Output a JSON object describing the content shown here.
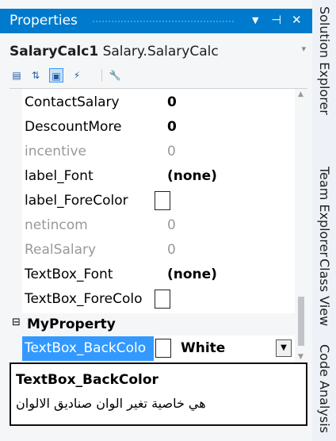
{
  "window": {
    "title": "Properties",
    "buttons": {
      "dropdown": "▼",
      "pin": "⊣",
      "close": "✕"
    }
  },
  "object_selector": {
    "name": "SalaryCalc1",
    "type": "Salary.SalaryCalc"
  },
  "toolbar": {
    "items": [
      {
        "icon": "categorized-icon",
        "state": "off"
      },
      {
        "icon": "alphabetical-icon",
        "state": "off"
      },
      {
        "icon": "properties-icon",
        "state": "on"
      },
      {
        "icon": "events-icon",
        "state": "off"
      },
      {
        "icon": "property-pages-icon",
        "state": "disabled"
      }
    ]
  },
  "properties": [
    {
      "name": "ContactSalary",
      "value": "0",
      "bold": true,
      "gray": false
    },
    {
      "name": "DescountMore",
      "value": "0",
      "bold": true,
      "gray": false
    },
    {
      "name": "incentive",
      "value": "0",
      "bold": false,
      "gray": true
    },
    {
      "name": "label_Font",
      "value": "(none)",
      "bold": true,
      "gray": false
    },
    {
      "name": "label_ForeColor",
      "value": "",
      "swatch": true,
      "gray": false
    },
    {
      "name": "netincom",
      "value": "0",
      "bold": false,
      "gray": true
    },
    {
      "name": "RealSalary",
      "value": "0",
      "bold": false,
      "gray": true
    },
    {
      "name": "TextBox_Font",
      "value": "(none)",
      "bold": true,
      "gray": false
    },
    {
      "name": "TextBox_ForeColo",
      "value": "",
      "swatch": true,
      "gray": false
    }
  ],
  "category": {
    "toggle": "⊟",
    "name": "MyProperty"
  },
  "selected_property": {
    "name": "TextBox_BackColo",
    "value": "White"
  },
  "description": {
    "title": "TextBox_BackColor",
    "text": "هي خاصية تغير الوان صناديق الالوان"
  },
  "side_tabs": [
    "Solution Explorer",
    "Team Explorer",
    "Class View",
    "Code Analysis"
  ],
  "colors": {
    "accent": "#007acc",
    "selection": "#3399ff"
  }
}
